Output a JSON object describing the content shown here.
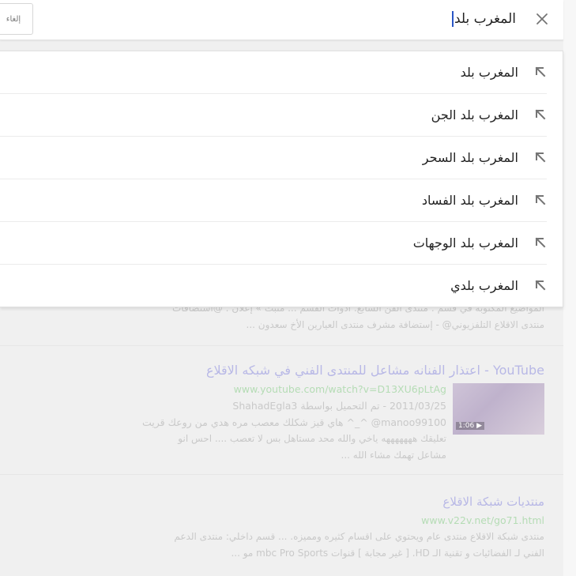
{
  "search": {
    "query": "المغرب بلد",
    "cancel_label": "إلغاء",
    "clear_icon": "close-icon"
  },
  "suggestions": [
    {
      "text": "المغرب بلد",
      "icon": "arrow-up-left-icon"
    },
    {
      "text": "المغرب بلد الجن",
      "icon": "arrow-up-left-icon"
    },
    {
      "text": "المغرب بلد السحر",
      "icon": "arrow-up-left-icon"
    },
    {
      "text": "المغرب بلد الفساد",
      "icon": "arrow-up-left-icon"
    },
    {
      "text": "المغرب بلد الوجهات",
      "icon": "arrow-up-left-icon"
    },
    {
      "text": "المغرب بلدي",
      "icon": "arrow-up-left-icon"
    }
  ],
  "results": [
    {
      "snippet": [
        "المواضيع المكتوبة في قسم : منتدى الفن السابع. ادوات القسم ... مثبت » إعلان : @استضافات",
        "منتدى الاقلاع التلفزيوني@ - إستضافة مشرف منتدى العيارين الأخ سعدون ..."
      ]
    },
    {
      "title": "YouTube - اعتذار الفنانه مشاعل للمنتدى الفني في شبكه الاقلاع",
      "url": "www.youtube.com/watch?v=D13XU6pLtAg",
      "date_line": "2011/03/25 - تم التحميل بواسطة ShahadEgla3",
      "thumb_duration": "1:06 ▶",
      "snippet": [
        "manoo99100@ ^_^ هاي قيز شكلك معصب مره هدي من روعك قريت",
        "تعليقك هههههههه ياخي والله محد مستاهل بس لا تعصب .... احس انو",
        "مشاعل تهمك مشاء الله ..."
      ]
    },
    {
      "title": "منتديات شبكة الاقلاع",
      "url": "www.v22v.net/go71.html",
      "snippet": [
        "منتدى شبكة الاقلاع منتدى عام ويحتوي على اقسام كثيره ومميزه. ... قسم داخلي: منتدى الدعم",
        "الفني لـ الفضائيات و تقنية الـ HD. [ غير مجابة ] قنوات mbc Pro Sports مو ..."
      ]
    }
  ],
  "colors": {
    "accent_caret": "#2a56c6",
    "text_primary": "#222222",
    "icon_gray": "#757575"
  }
}
